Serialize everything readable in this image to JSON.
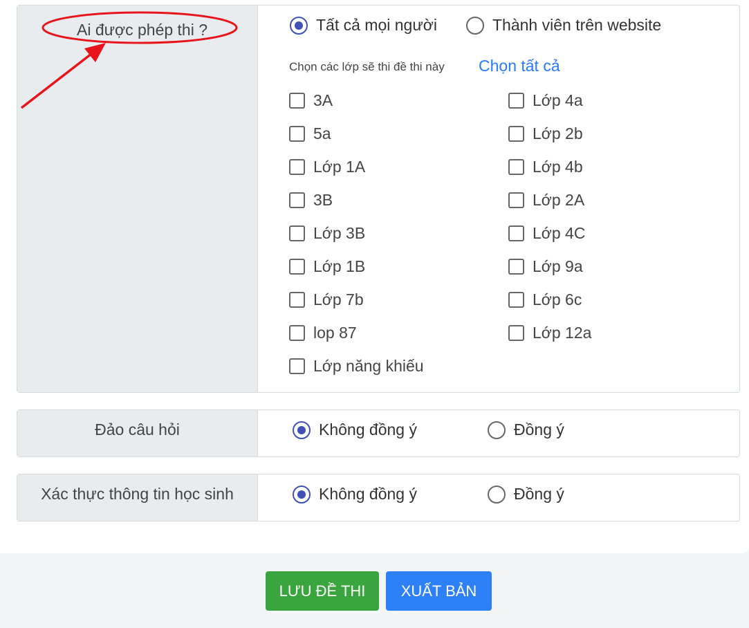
{
  "who_can_take": {
    "label": "Ai được phép thi ?",
    "options": [
      {
        "label": "Tất cả mọi người",
        "selected": true
      },
      {
        "label": "Thành viên trên website",
        "selected": false
      }
    ],
    "class_hint": "Chọn các lớp sẽ thi đề thi này",
    "select_all": "Chọn tất cả",
    "classes_left": [
      "3A",
      "5a",
      "Lớp 1A",
      "3B",
      "Lớp 3B",
      "Lớp 1B",
      "Lớp 7b",
      "lop 87",
      "Lớp năng khiếu"
    ],
    "classes_right": [
      "Lớp 4a",
      "Lớp 2b",
      "Lớp 4b",
      "Lớp 2A",
      "Lớp 4C",
      "Lớp 9a",
      "Lớp 6c",
      "Lớp 12a"
    ]
  },
  "shuffle_questions": {
    "label": "Đảo câu hỏi",
    "options": [
      {
        "label": "Không đồng ý",
        "selected": true
      },
      {
        "label": "Đồng ý",
        "selected": false
      }
    ]
  },
  "verify_student": {
    "label": "Xác thực thông tin học sinh",
    "options": [
      {
        "label": "Không đồng ý",
        "selected": true
      },
      {
        "label": "Đồng ý",
        "selected": false
      }
    ]
  },
  "buttons": {
    "save": "LƯU ĐỀ THI",
    "publish": "XUẤT BẢN"
  },
  "colors": {
    "accent": "#3f51b5",
    "link": "#2979ff",
    "save": "#3aa53e",
    "publish": "#2d80f5",
    "annotation": "#e8141c"
  }
}
